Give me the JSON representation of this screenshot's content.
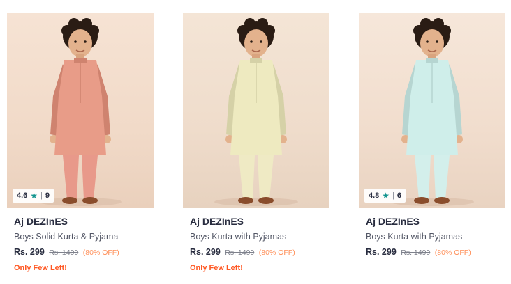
{
  "products": [
    {
      "rating": "4.6",
      "rating_count": "9",
      "brand": "Aj DEZInES",
      "name": "Boys Solid Kurta & Pyjama",
      "price": "Rs. 299",
      "mrp": "Rs. 1499",
      "discount": "(80% OFF)",
      "stock": "Only Few Left!",
      "kurta_color": "#e89c88",
      "pyjama_color": "#e8998a"
    },
    {
      "rating": "",
      "rating_count": "",
      "brand": "Aj DEZInES",
      "name": "Boys Kurta with Pyjamas",
      "price": "Rs. 299",
      "mrp": "Rs. 1499",
      "discount": "(80% OFF)",
      "stock": "Only Few Left!",
      "kurta_color": "#eeeac0",
      "pyjama_color": "#efeac4"
    },
    {
      "rating": "4.8",
      "rating_count": "6",
      "brand": "Aj DEZInES",
      "name": "Boys Kurta with Pyjamas",
      "price": "Rs. 299",
      "mrp": "Rs. 1499",
      "discount": "(80% OFF)",
      "stock": "",
      "kurta_color": "#cfeeea",
      "pyjama_color": "#d3efeb"
    }
  ],
  "icons": {
    "rating_star": "star-icon"
  },
  "colors": {
    "accent_star": "#14958f",
    "discount": "#ff905a",
    "stock_alert": "#ff5722"
  }
}
